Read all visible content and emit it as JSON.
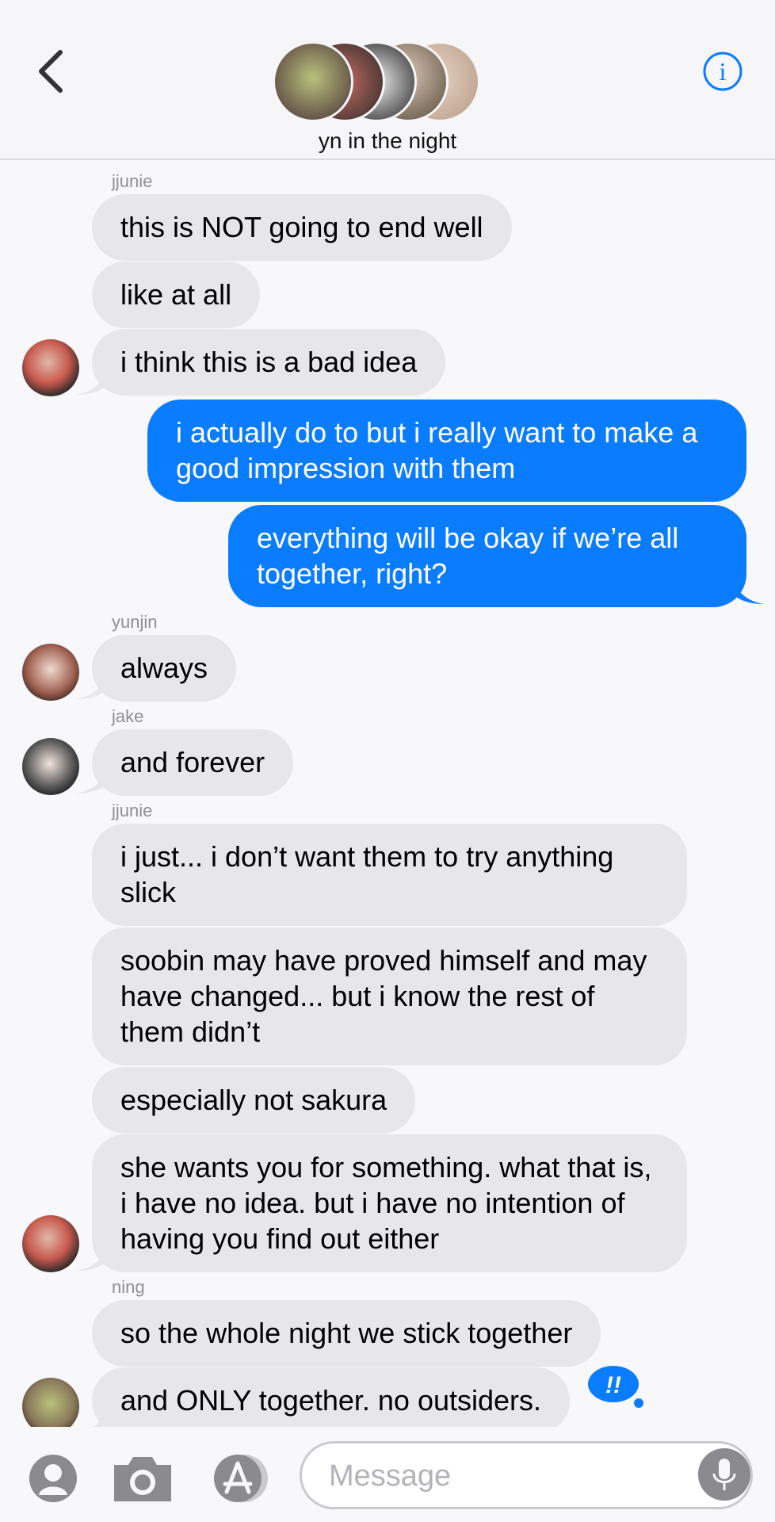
{
  "header": {
    "group_name": "yn in the night",
    "back_icon": "chevron-left-icon",
    "info_icon": "info-icon",
    "accent": "#0a7cff"
  },
  "messages": [
    {
      "sender": "jjunie"
    },
    {
      "text": "this is NOT going to end well"
    },
    {
      "text": "like at all"
    },
    {
      "text": "i think this is a bad idea"
    },
    {
      "text": "i actually do to but i really want to make a good impression with them"
    },
    {
      "text": "everything will be okay if we’re all together, right?"
    },
    {
      "sender": "yunjin"
    },
    {
      "text": "always"
    },
    {
      "sender": "jake"
    },
    {
      "text": "and forever"
    },
    {
      "sender": "jjunie"
    },
    {
      "text": "i just... i don’t want them to try anything slick"
    },
    {
      "text": "soobin may have proved himself and may have changed... but i know the rest of them didn’t"
    },
    {
      "text": "especially not sakura"
    },
    {
      "text": "she wants you for something. what that is, i have no idea. but i have no intention of having you find out either"
    },
    {
      "sender": "ning"
    },
    {
      "text": "so the whole night we stick together"
    },
    {
      "text": "and ONLY together. no outsiders."
    }
  ],
  "reaction": {
    "text": "!!",
    "icon": "emphasis-reaction-icon"
  },
  "composer": {
    "placeholder": "Message",
    "icons": [
      "memoji-icon",
      "camera-icon",
      "app-store-icon",
      "microphone-icon"
    ]
  }
}
